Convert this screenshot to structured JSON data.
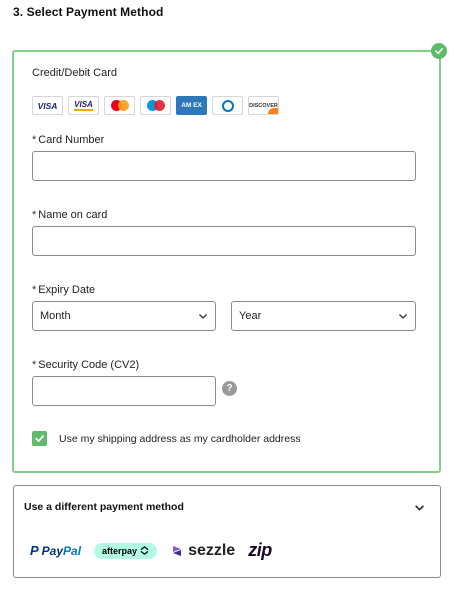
{
  "section": {
    "title": "3. Select Payment Method"
  },
  "card_panel": {
    "title": "Credit/Debit Card",
    "selected": true,
    "accent": "#5dbb6a",
    "logos": [
      {
        "name": "visa",
        "text": "VISA"
      },
      {
        "name": "visa-electron",
        "text": "VISA"
      },
      {
        "name": "mastercard"
      },
      {
        "name": "maestro"
      },
      {
        "name": "amex",
        "text": "AM EX"
      },
      {
        "name": "diners-club"
      },
      {
        "name": "discover",
        "text": "DISCOVER"
      }
    ],
    "fields": {
      "required_marker": "*",
      "card_number": {
        "label": "Card Number",
        "value": ""
      },
      "name_on_card": {
        "label": "Name on card",
        "value": ""
      },
      "expiry": {
        "label": "Expiry Date",
        "month": {
          "selected": "Month"
        },
        "year": {
          "selected": "Year"
        }
      },
      "security_code": {
        "label": "Security Code (CV2)",
        "value": "",
        "help": "?"
      }
    },
    "checkbox": {
      "checked": true,
      "label": "Use my shipping address as my cardholder address"
    }
  },
  "alt_panel": {
    "title": "Use a different payment method",
    "logos": [
      {
        "name": "paypal",
        "mark": "P",
        "pay": "Pay",
        "pal": "Pal"
      },
      {
        "name": "afterpay",
        "text": "afterpay"
      },
      {
        "name": "sezzle",
        "text": "sezzle"
      },
      {
        "name": "zip",
        "text": "zip"
      }
    ]
  }
}
